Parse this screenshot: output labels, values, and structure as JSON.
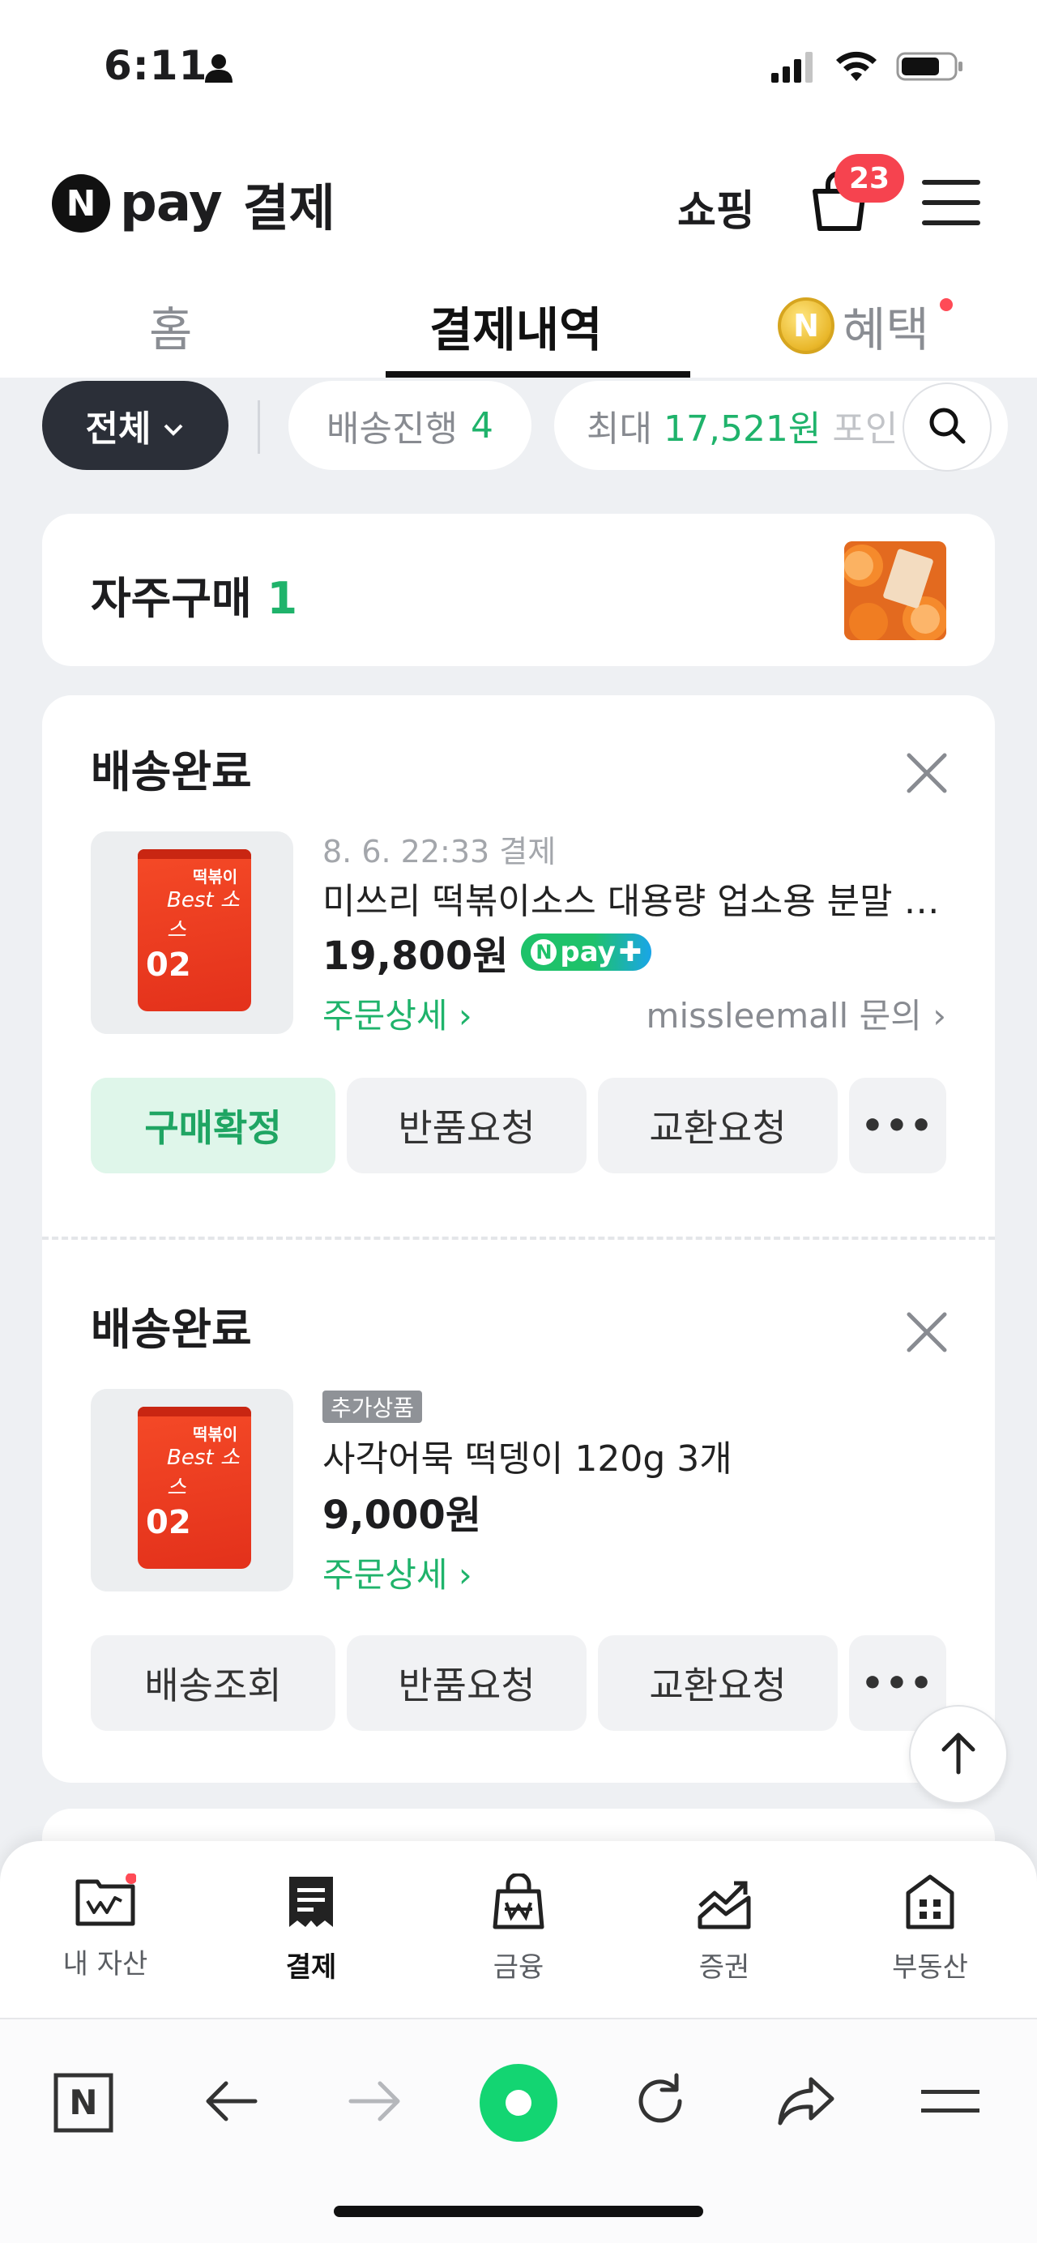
{
  "status_bar": {
    "time": "6:11"
  },
  "header": {
    "logo_n": "N",
    "logo_pay": "pay",
    "title": "결제",
    "shopping": "쇼핑",
    "cart_count": "23"
  },
  "tabs": [
    {
      "label": "홈"
    },
    {
      "label": "결제내역"
    },
    {
      "label": "혜택",
      "coin": "N"
    }
  ],
  "filters": {
    "all_label": "전체",
    "shipping_label": "배송진행",
    "shipping_count": "4",
    "point_prefix": "최대",
    "point_amount": "17,521원",
    "point_suffix": "포인"
  },
  "frequent": {
    "label": "자주구매",
    "count": "1"
  },
  "orders": [
    {
      "status": "배송완료",
      "date": "8. 6. 22:33 결제",
      "name": "미쓰리 떡볶이소스 대용량 업소용 분말 …",
      "price": "19,800원",
      "npay_label": "pay",
      "detail_link": "주문상세 ›",
      "seller_link": "missleemall 문의 ›",
      "buttons": [
        "구매확정",
        "반품요청",
        "교환요청",
        "•••"
      ],
      "pack": {
        "brand": "떡볶이",
        "script": "Best 소스",
        "num": "02"
      }
    },
    {
      "status": "배송완료",
      "tag": "추가상품",
      "name": "사각어묵 떡뎅이 120g 3개",
      "price": "9,000원",
      "detail_link": "주문상세 ›",
      "buttons": [
        "배송조회",
        "반품요청",
        "교환요청",
        "•••"
      ],
      "pack": {
        "brand": "떡볶이",
        "script": "Best 소스",
        "num": "02"
      }
    }
  ],
  "bottom_nav": [
    {
      "label": "내 자산",
      "icon": "wallet-chart-icon"
    },
    {
      "label": "결제",
      "icon": "receipt-icon"
    },
    {
      "label": "금융",
      "icon": "money-bag-icon"
    },
    {
      "label": "증권",
      "icon": "stock-chart-icon"
    },
    {
      "label": "부동산",
      "icon": "building-icon"
    }
  ],
  "browser_bar": {
    "n_label": "N"
  },
  "colors": {
    "accent_green": "#1fb36b",
    "badge_red": "#f6434f",
    "chip_dark": "#2b2f38"
  }
}
